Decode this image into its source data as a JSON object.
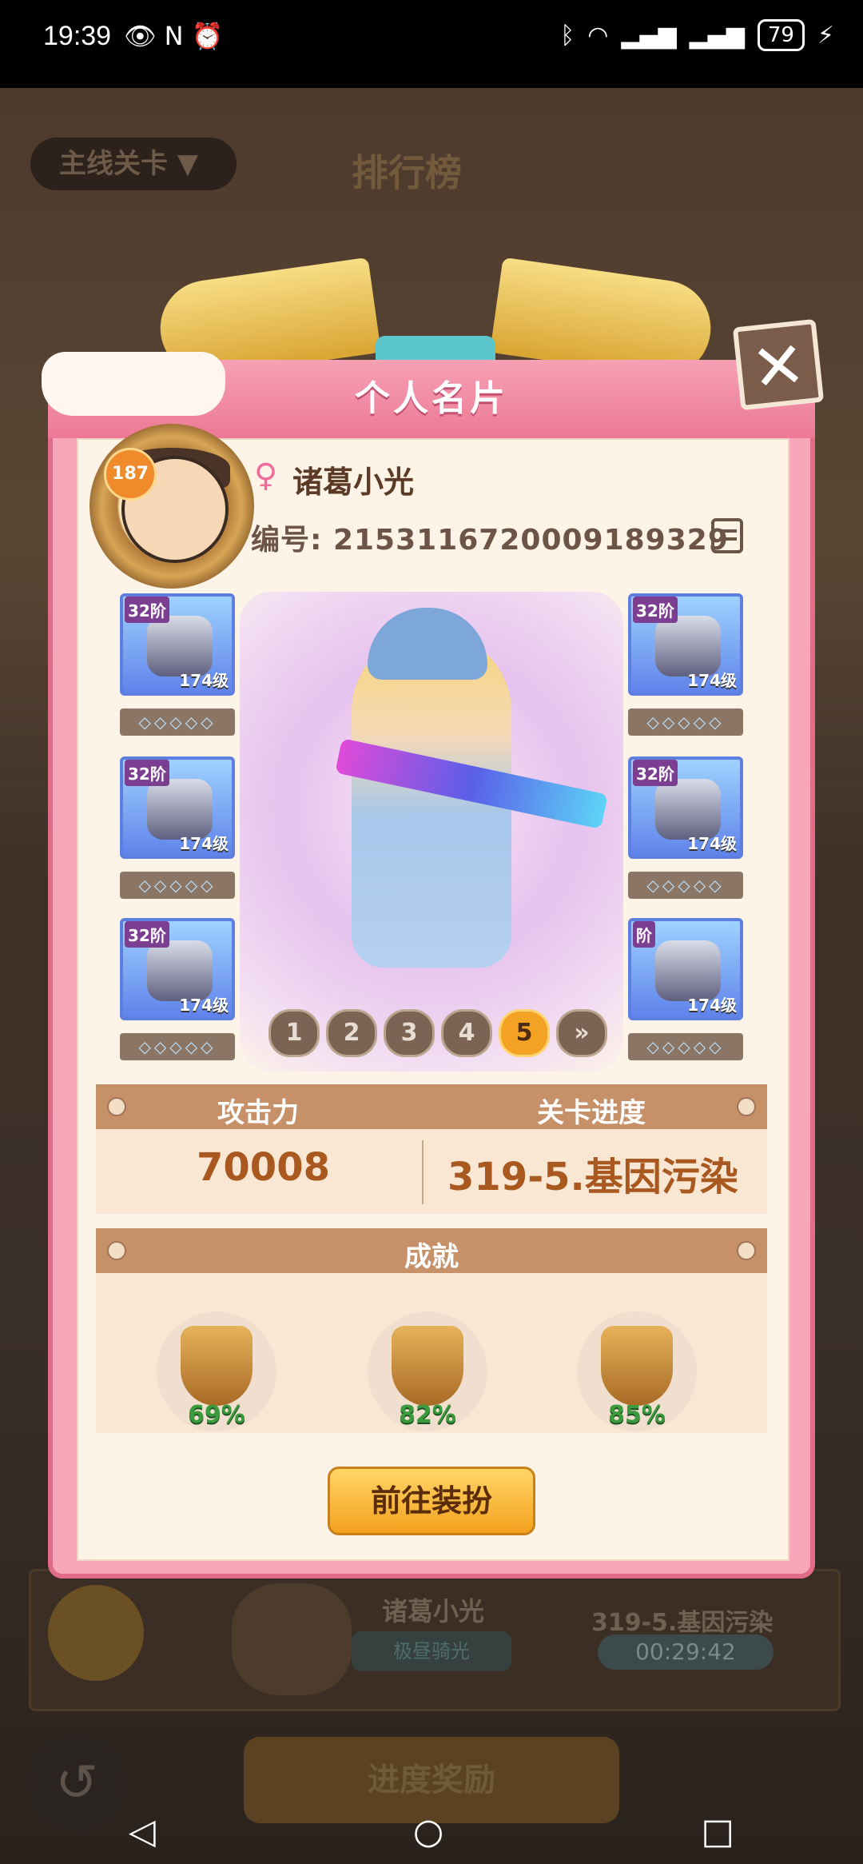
{
  "status_bar": {
    "time": "19:39",
    "battery": "79",
    "icons_left": [
      "eye-icon",
      "nfc-icon",
      "alarm-icon"
    ],
    "icons_right": [
      "bluetooth-icon",
      "wifi-icon",
      "signal-icon",
      "signal-icon",
      "battery-icon",
      "charging-icon"
    ]
  },
  "background": {
    "dropdown_label": "主线关卡",
    "title": "排行榜",
    "rank_row": {
      "name": "诸葛小光",
      "badge": "极昼骑光",
      "stage": "319-5.基因污染",
      "timer": "00:29:42"
    },
    "reward_button": "进度奖励"
  },
  "card": {
    "title": "个人名片",
    "close_icon": "close-icon",
    "player": {
      "level": "187",
      "gender_icon": "female-icon",
      "name": "诸葛小光",
      "id_label": "编号:",
      "id_value": "2153116720009189329"
    },
    "equipment_left": [
      {
        "tier": "32阶",
        "level": "174级"
      },
      {
        "tier": "32阶",
        "level": "174级"
      },
      {
        "tier": "32阶",
        "level": "174级"
      }
    ],
    "equipment_right": [
      {
        "tier": "32阶",
        "level": "174级"
      },
      {
        "tier": "32阶",
        "level": "174级"
      },
      {
        "tier": "阶",
        "level": "174级"
      }
    ],
    "pager": {
      "pages": [
        "1",
        "2",
        "3",
        "4",
        "5"
      ],
      "active": "5",
      "next": "»"
    },
    "stats": {
      "attack_label": "攻击力",
      "attack_value": "70008",
      "progress_label": "关卡进度",
      "progress_value": "319-5.基因污染"
    },
    "achievements": {
      "title": "成就",
      "items": [
        {
          "icon": "pistol-icon",
          "percent": "69%"
        },
        {
          "icon": "card-icon",
          "percent": "82%"
        },
        {
          "icon": "turret-icon",
          "percent": "85%"
        }
      ]
    },
    "dress_button": "前往装扮"
  },
  "colors": {
    "panel_pink": "#f7a7b9",
    "panel_border": "#e26b88",
    "button_orange": "#f4a11e",
    "stat_header": "#c69068",
    "value_brown": "#a9581f",
    "percent_green": "#3a9a3d"
  }
}
